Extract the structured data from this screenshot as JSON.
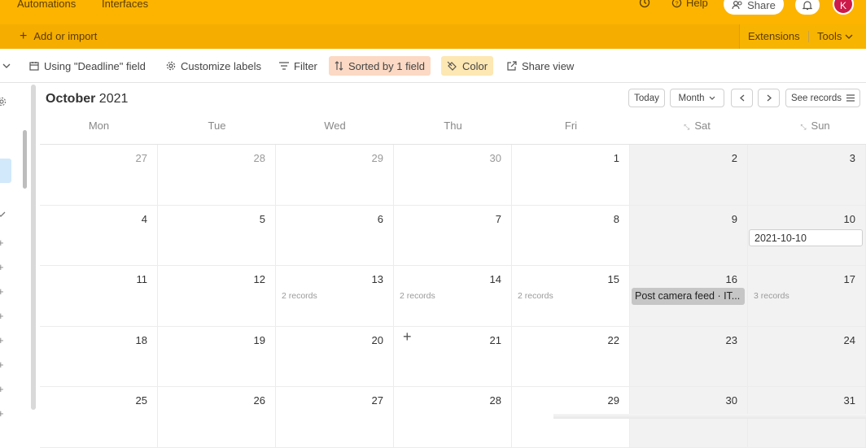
{
  "topbar": {
    "nav_automations": "Automations",
    "nav_interfaces": "Interfaces",
    "help_label": "Help",
    "share_label": "Share",
    "avatar_initial": "K"
  },
  "subbar": {
    "add_import_label": "Add or import",
    "extensions_label": "Extensions",
    "tools_label": "Tools"
  },
  "viewbar": {
    "using_field_label": "Using \"Deadline\" field",
    "customize_labels": "Customize labels",
    "filter_label": "Filter",
    "sorted_label": "Sorted by 1 field",
    "color_label": "Color",
    "share_view_label": "Share view"
  },
  "calendar": {
    "month": "October",
    "year": "2021",
    "today_label": "Today",
    "view_mode": "Month",
    "see_records_label": "See records",
    "days_of_week": [
      "Mon",
      "Tue",
      "Wed",
      "Thu",
      "Fri",
      "Sat",
      "Sun"
    ],
    "weeks": [
      [
        {
          "day": "27",
          "other": true
        },
        {
          "day": "28",
          "other": true
        },
        {
          "day": "29",
          "other": true
        },
        {
          "day": "30",
          "other": true
        },
        {
          "day": "1"
        },
        {
          "day": "2"
        },
        {
          "day": "3"
        }
      ],
      [
        {
          "day": "4"
        },
        {
          "day": "5"
        },
        {
          "day": "6"
        },
        {
          "day": "7"
        },
        {
          "day": "8"
        },
        {
          "day": "9"
        },
        {
          "day": "10"
        }
      ],
      [
        {
          "day": "11"
        },
        {
          "day": "12"
        },
        {
          "day": "13",
          "records": "2 records"
        },
        {
          "day": "14",
          "records": "2 records"
        },
        {
          "day": "15",
          "records": "2 records"
        },
        {
          "day": "16"
        },
        {
          "day": "17",
          "records": "3 records"
        }
      ],
      [
        {
          "day": "18"
        },
        {
          "day": "19"
        },
        {
          "day": "20"
        },
        {
          "day": "21"
        },
        {
          "day": "22"
        },
        {
          "day": "23"
        },
        {
          "day": "24"
        }
      ],
      [
        {
          "day": "25"
        },
        {
          "day": "26"
        },
        {
          "day": "27"
        },
        {
          "day": "28"
        },
        {
          "day": "29"
        },
        {
          "day": "30"
        },
        {
          "day": "31"
        }
      ]
    ],
    "date_input_value": "2021-10-10",
    "event_chip_label": "Post camera feed · IT..."
  },
  "colors": {
    "topbar": "#fcb400",
    "subbar": "#f5ad00",
    "sorted_bg": "#fbd9c4",
    "color_bg": "#fde7b3",
    "weekend_bg": "#f2f2f2"
  }
}
